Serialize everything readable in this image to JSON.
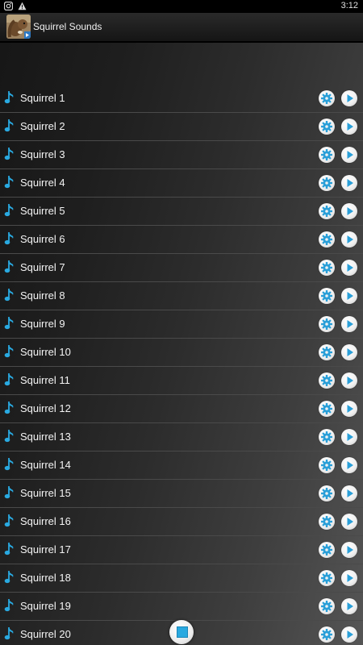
{
  "status_bar": {
    "time": "3:12",
    "icons": [
      "camera-icon",
      "warning-icon"
    ]
  },
  "action_bar": {
    "title": "Squirrel Sounds",
    "icon": "squirrel-app-icon"
  },
  "colors": {
    "accent": "#29a9e0",
    "text": "#f4f4f4"
  },
  "list": {
    "item_icon": "music-note-icon",
    "settings_icon": "gear-icon",
    "play_icon": "play-icon",
    "items": [
      {
        "label": "Squirrel 1"
      },
      {
        "label": "Squirrel 2"
      },
      {
        "label": "Squirrel 3"
      },
      {
        "label": "Squirrel 4"
      },
      {
        "label": "Squirrel 5"
      },
      {
        "label": "Squirrel 6"
      },
      {
        "label": "Squirrel 7"
      },
      {
        "label": "Squirrel 8"
      },
      {
        "label": "Squirrel 9"
      },
      {
        "label": "Squirrel 10"
      },
      {
        "label": "Squirrel 11"
      },
      {
        "label": "Squirrel 12"
      },
      {
        "label": "Squirrel 13"
      },
      {
        "label": "Squirrel 14"
      },
      {
        "label": "Squirrel 15"
      },
      {
        "label": "Squirrel 16"
      },
      {
        "label": "Squirrel 17"
      },
      {
        "label": "Squirrel 18"
      },
      {
        "label": "Squirrel 19"
      },
      {
        "label": "Squirrel 20"
      }
    ]
  },
  "floating_button": {
    "icon": "stop-icon"
  }
}
